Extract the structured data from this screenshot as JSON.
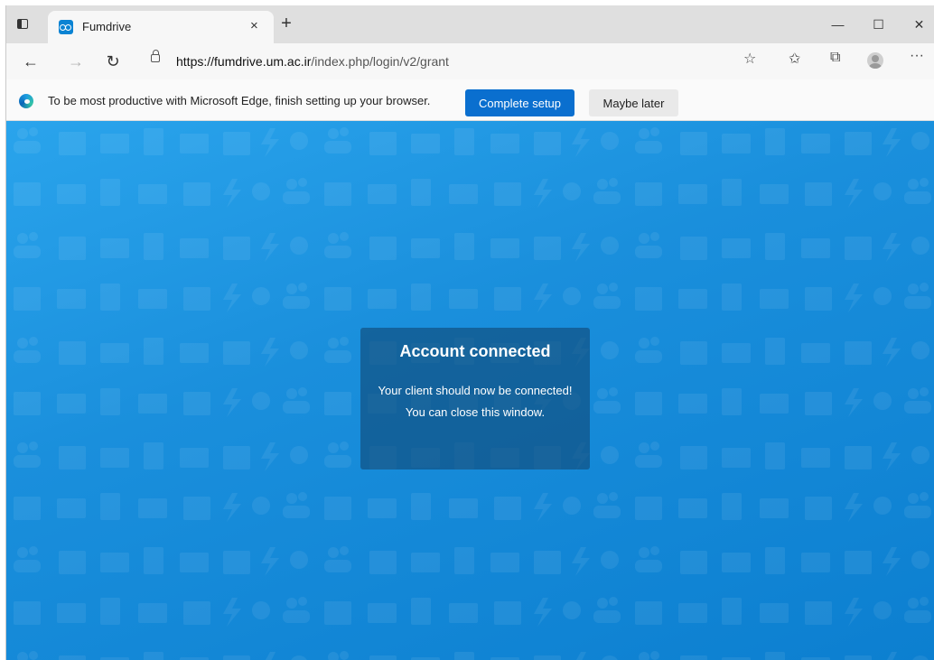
{
  "tab": {
    "title": "Fumdrive",
    "close": "×"
  },
  "toolbar": {
    "new_tab": "+",
    "minimize": "—",
    "maximize": "☐",
    "close": "✕",
    "back": "←",
    "forward": "→",
    "refresh": "↻",
    "more": "···"
  },
  "address": {
    "url_host": "https://fumdrive.um.ac.ir",
    "url_path": "/index.php/login/v2/grant"
  },
  "infobar": {
    "message": "To be most productive with Microsoft Edge, finish setting up your browser.",
    "primary_label": "Complete setup",
    "secondary_label": "Maybe later"
  },
  "modal": {
    "title": "Account connected",
    "line1": "Your client should now be connected!",
    "line2": "You can close this window."
  },
  "colors": {
    "accent": "#0a6fcf",
    "page_bg": "#1a8fdc",
    "modal_bg": "#104876"
  }
}
